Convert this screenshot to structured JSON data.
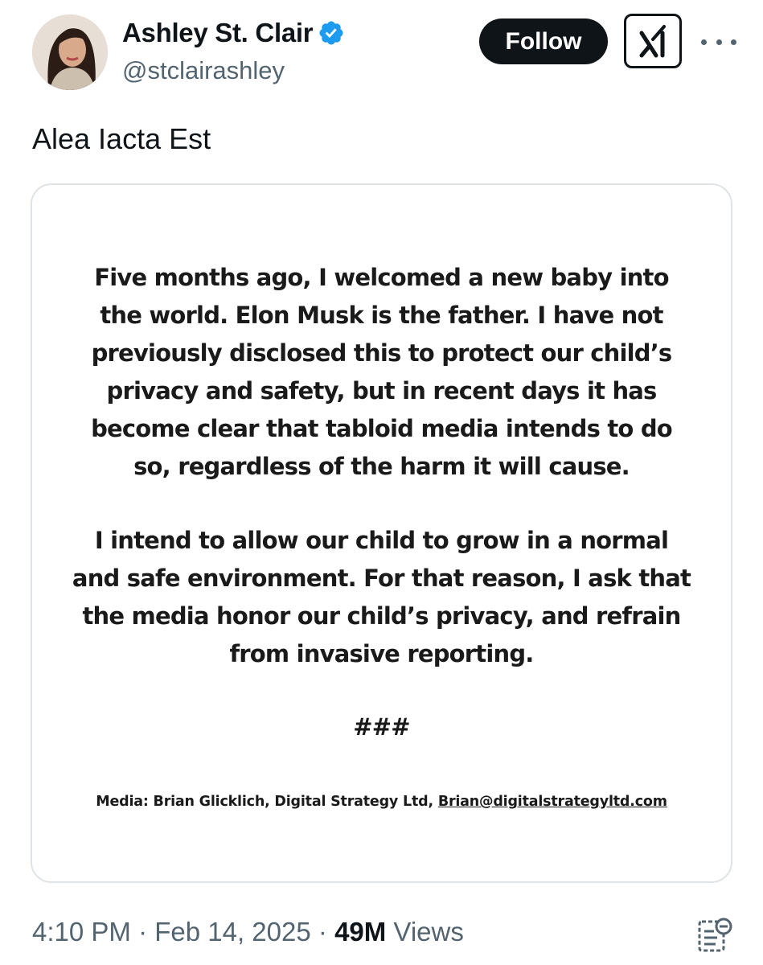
{
  "author": {
    "display_name": "Ashley St. Clair",
    "handle": "@stclairashley",
    "verified": true,
    "avatar_icon": "profile-photo"
  },
  "actions": {
    "follow_label": "Follow",
    "grok_icon": "grok-logo-icon",
    "more_icon": "more-dots-icon"
  },
  "tweet": {
    "text": "Alea Iacta Est"
  },
  "media": {
    "paragraph_1": [
      "Five months ago, I welcomed a new baby into",
      "the world. Elon Musk is the father. I have not",
      "previously disclosed this to protect our child’s",
      "privacy and safety, but in recent days it has",
      "become clear that tabloid media intends to do",
      "so, regardless of the harm it will cause."
    ],
    "paragraph_2": [
      "I intend to allow our child to grow in a normal",
      "and safe environment. For that reason, I ask that",
      "the media honor our child’s privacy, and refrain",
      "from invasive reporting."
    ],
    "separator": "###",
    "contact_prefix": "Media: Brian Glicklich, Digital Strategy Ltd, ",
    "contact_email": "Brian@digitalstrategyltd.com"
  },
  "meta": {
    "time": "4:10 PM",
    "dot1": " · ",
    "date": "Feb 14, 2025",
    "dot2": " · ",
    "views_count": "49M",
    "views_label": " Views"
  },
  "colors": {
    "verified": "#1d9bf0",
    "text_primary": "#0f1419",
    "text_secondary": "#536471"
  }
}
